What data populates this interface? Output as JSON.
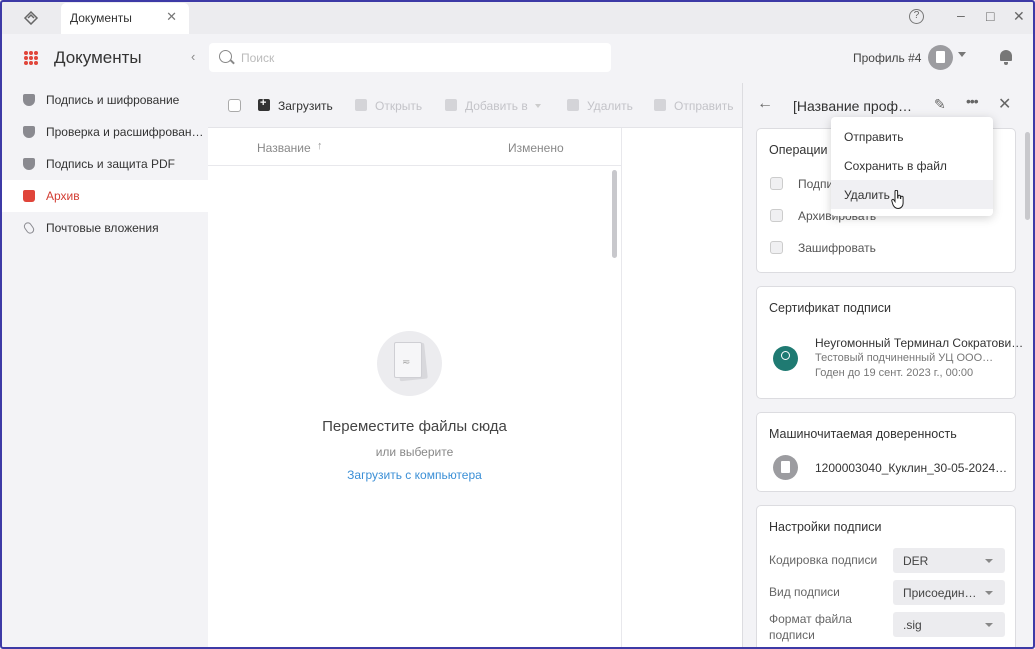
{
  "window": {
    "tab_label": "Документы",
    "tab_close": "✕",
    "help": "?",
    "minimize": "–",
    "maximize": "□",
    "close": "✕"
  },
  "header": {
    "app_title": "Документы",
    "search_placeholder": "Поиск",
    "search_value": "",
    "profile_label": "Профиль #4"
  },
  "sidebar": {
    "items": [
      {
        "label": "Подпись и шифрование",
        "icon": "shield-icon",
        "active": false
      },
      {
        "label": "Проверка и расшифрован…",
        "icon": "shield-check-icon",
        "active": false
      },
      {
        "label": "Подпись и защита PDF",
        "icon": "pdf-shield-icon",
        "active": false
      },
      {
        "label": "Архив",
        "icon": "archive-icon",
        "active": true
      },
      {
        "label": "Почтовые вложения",
        "icon": "paperclip-icon",
        "active": false
      }
    ]
  },
  "toolbar": {
    "upload": "Загрузить",
    "open": "Открыть",
    "add_to": "Добавить в",
    "delete": "Удалить",
    "send": "Отправить"
  },
  "file_list": {
    "columns": {
      "name": "Название",
      "changed": "Изменено"
    },
    "sort_indicator": "↑",
    "empty_title": "Переместите файлы сюда",
    "empty_sub": "или выберите",
    "empty_link": "Загрузить с компьютера"
  },
  "panel": {
    "title": "[Название проф…",
    "back": "←",
    "close": "✕",
    "operations": {
      "title": "Операции д",
      "items": [
        "Подпи",
        "Архивировать",
        "Зашифровать"
      ]
    },
    "certificate": {
      "title": "Сертификат подписи",
      "name": "Неугомонный Терминал Сократови…",
      "issuer": "Тестовый подчиненный УЦ ООО…",
      "valid": "Годен до 19 сент. 2023 г., 00:00"
    },
    "poa": {
      "title": "Машиночитаемая доверенность",
      "name": "1200003040_Куклин_30-05-2024…"
    },
    "settings": {
      "title": "Настройки подписи",
      "encoding_label": "Кодировка подписи",
      "encoding_value": "DER",
      "type_label": "Вид подписи",
      "type_value": "Присоедин…",
      "format_label": "Формат файла подписи",
      "format_value": ".sig"
    }
  },
  "menu": {
    "items": [
      "Отправить",
      "Сохранить в файл",
      "Удалить"
    ],
    "hover_index": 2
  },
  "colors": {
    "accent": "#d23d33",
    "link": "#3b8fd6",
    "cert_icon": "#1f7a72"
  }
}
